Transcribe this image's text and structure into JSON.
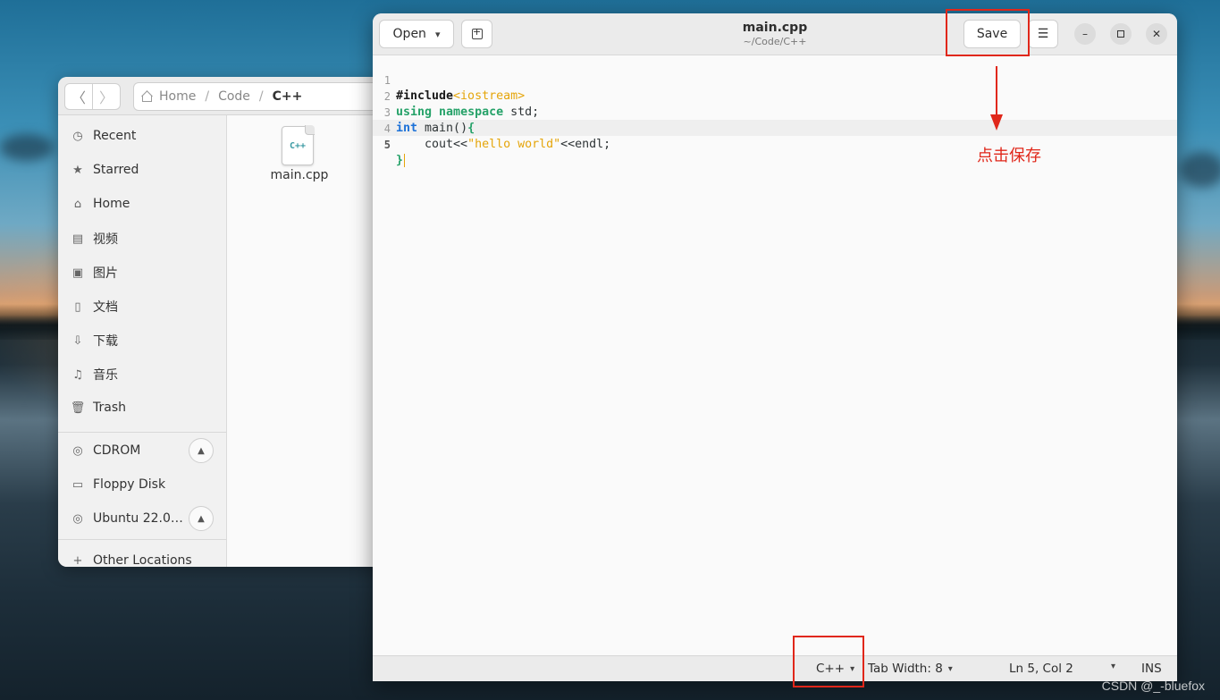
{
  "files_window": {
    "path": {
      "home": "Home",
      "folder": "Code",
      "current": "C++"
    },
    "sidebar": [
      {
        "label": "Recent",
        "icon": "clock-icon"
      },
      {
        "label": "Starred",
        "icon": "star-icon"
      },
      {
        "label": "Home",
        "icon": "home-icon"
      },
      {
        "label": "视频",
        "icon": "video-icon"
      },
      {
        "label": "图片",
        "icon": "image-icon"
      },
      {
        "label": "文档",
        "icon": "document-icon"
      },
      {
        "label": "下载",
        "icon": "download-icon"
      },
      {
        "label": "音乐",
        "icon": "music-icon"
      },
      {
        "label": "Trash",
        "icon": "trash-icon"
      }
    ],
    "devices": [
      {
        "label": "CDROM",
        "icon": "disc-icon",
        "eject": true
      },
      {
        "label": "Floppy Disk",
        "icon": "drive-icon",
        "eject": false
      },
      {
        "label": "Ubuntu 22.0…",
        "icon": "disc-icon",
        "eject": true
      }
    ],
    "other_locations": "Other Locations",
    "file": {
      "tag": "C++",
      "name": "main.cpp"
    }
  },
  "editor": {
    "open_label": "Open",
    "title": "main.cpp",
    "subtitle": "~/Code/C++",
    "save_label": "Save",
    "line_numbers": [
      "1",
      "2",
      "3",
      "4",
      "5"
    ],
    "code": {
      "l1_pre": "#include",
      "l1_inc": "<iostream>",
      "l2_kw1": "using",
      "l2_kw2": "namespace",
      "l2_rest": " std;",
      "l3_kw": "int",
      "l3_rest": " main()",
      "l3_brace": "{",
      "l4_pre": "    cout<<",
      "l4_str": "\"hello world\"",
      "l4_post": "<<endl;",
      "l5_brace": "}"
    },
    "status": {
      "language": "C++",
      "tab_width": "Tab Width: 8",
      "position": "Ln 5, Col 2",
      "mode": "INS"
    }
  },
  "annotation": {
    "text": "点击保存",
    "color": "#e0271a"
  },
  "watermark": "CSDN @_-bluefox"
}
